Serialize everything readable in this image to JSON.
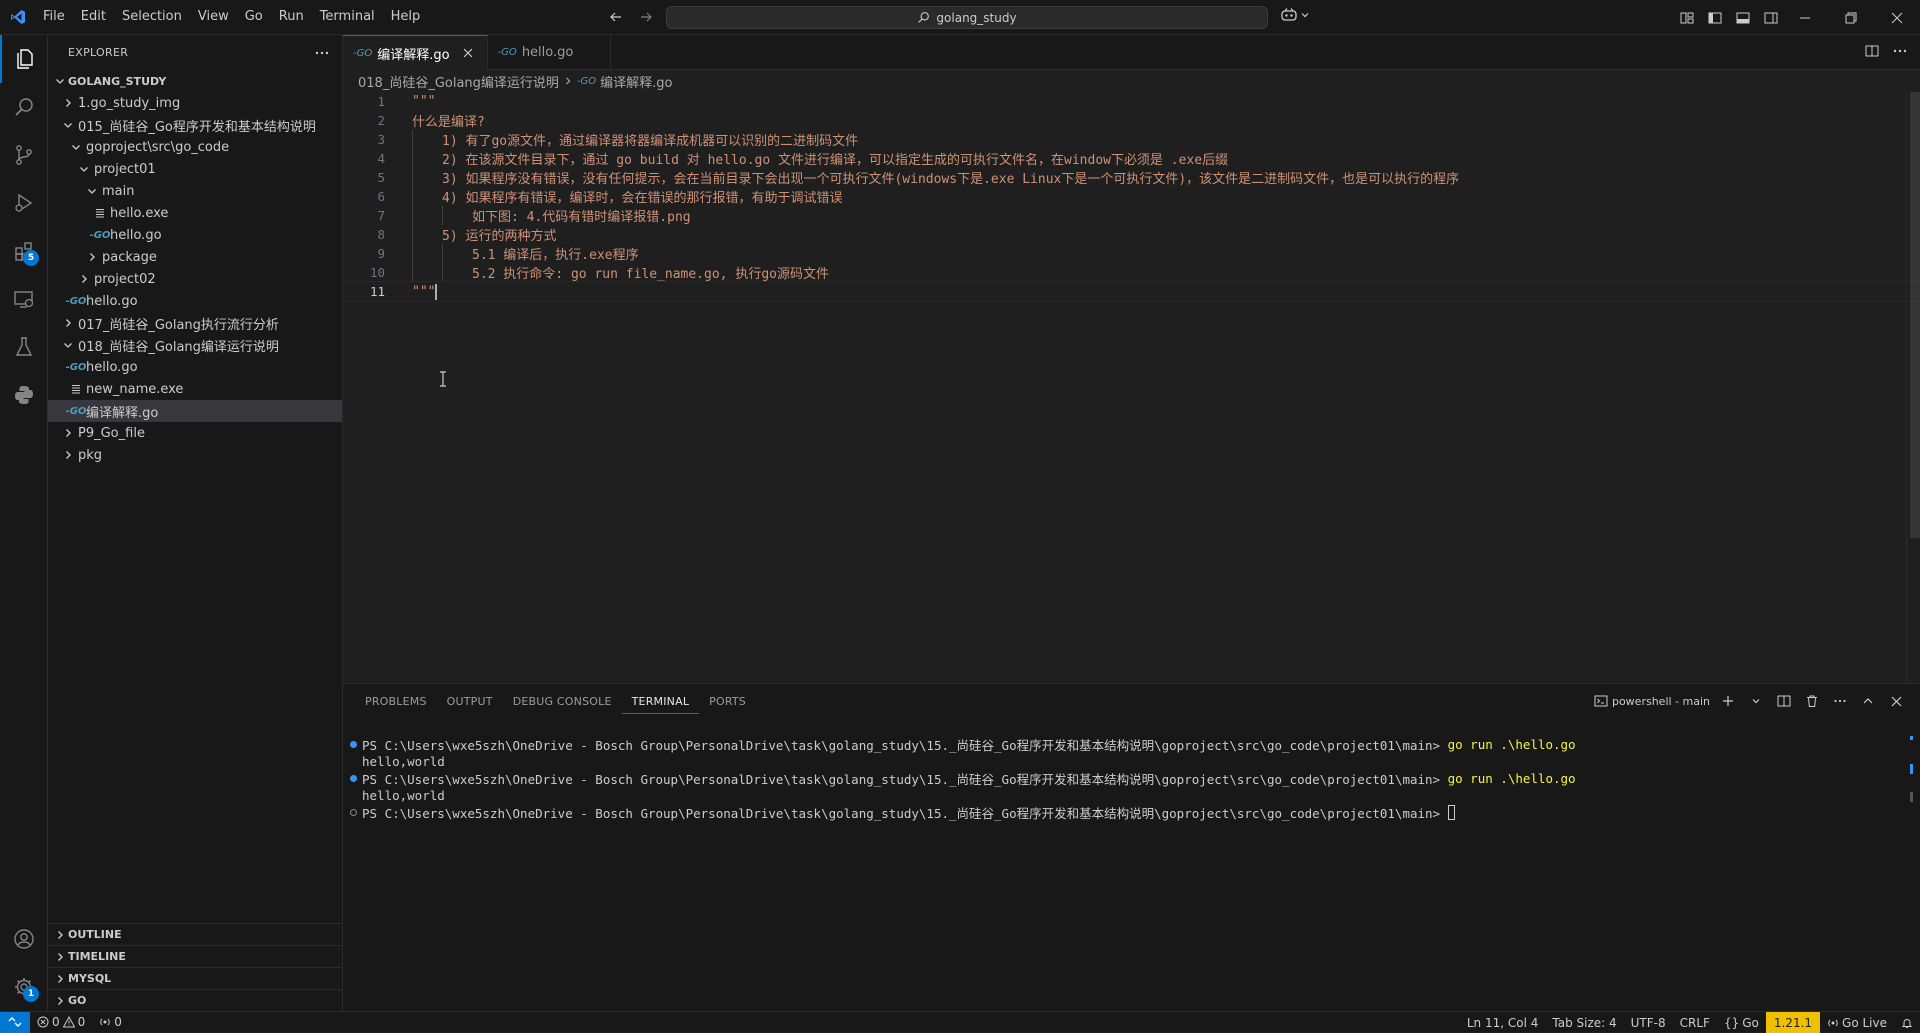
{
  "titlebar": {
    "menus": [
      "File",
      "Edit",
      "Selection",
      "View",
      "Go",
      "Run",
      "Terminal",
      "Help"
    ],
    "search_text": "golang_study"
  },
  "activity_badges": {
    "extensions": "5",
    "manage": "1"
  },
  "explorer": {
    "title": "EXPLORER",
    "root": "GOLANG_STUDY",
    "tree": [
      {
        "label": "1.go_study_img",
        "depth": 0,
        "kind": "folder",
        "expanded": false
      },
      {
        "label": "015_尚硅谷_Go程序开发和基本结构说明",
        "depth": 0,
        "kind": "folder",
        "expanded": true
      },
      {
        "label": "goproject\\src\\go_code",
        "depth": 1,
        "kind": "folder",
        "expanded": true
      },
      {
        "label": "project01",
        "depth": 2,
        "kind": "folder",
        "expanded": true
      },
      {
        "label": "main",
        "depth": 3,
        "kind": "folder",
        "expanded": true
      },
      {
        "label": "hello.exe",
        "depth": 4,
        "kind": "exe"
      },
      {
        "label": "hello.go",
        "depth": 4,
        "kind": "go"
      },
      {
        "label": "package",
        "depth": 3,
        "kind": "folder",
        "expanded": false
      },
      {
        "label": "project02",
        "depth": 2,
        "kind": "folder",
        "expanded": false
      },
      {
        "label": "hello.go",
        "depth": 1,
        "kind": "go"
      },
      {
        "label": "017_尚硅谷_Golang执行流行分析",
        "depth": 0,
        "kind": "folder",
        "expanded": false
      },
      {
        "label": "018_尚硅谷_Golang编译运行说明",
        "depth": 0,
        "kind": "folder",
        "expanded": true
      },
      {
        "label": "hello.go",
        "depth": 1,
        "kind": "go"
      },
      {
        "label": "new_name.exe",
        "depth": 1,
        "kind": "exe"
      },
      {
        "label": "编译解释.go",
        "depth": 1,
        "kind": "go",
        "selected": true
      },
      {
        "label": "P9_Go_file",
        "depth": 0,
        "kind": "folder",
        "expanded": false
      },
      {
        "label": "pkg",
        "depth": 0,
        "kind": "folder",
        "expanded": false
      }
    ],
    "sections": [
      "OUTLINE",
      "TIMELINE",
      "MYSQL",
      "GO"
    ]
  },
  "editor": {
    "tabs": [
      {
        "label": "编译解释.go",
        "active": true
      },
      {
        "label": "hello.go",
        "active": false
      }
    ],
    "breadcrumb": [
      "018_尚硅谷_Golang编译运行说明",
      "编译解释.go"
    ],
    "lines": [
      {
        "n": "1",
        "indent": 0,
        "text": "\"\"\""
      },
      {
        "n": "2",
        "indent": 0,
        "text": "什么是编译?"
      },
      {
        "n": "3",
        "indent": 1,
        "text": "1) 有了go源文件，通过编译器将器编译成机器可以识别的二进制码文件"
      },
      {
        "n": "4",
        "indent": 1,
        "text": "2) 在该源文件目录下，通过 go build 对 hello.go 文件进行编译，可以指定生成的可执行文件名，在window下必须是 .exe后缀"
      },
      {
        "n": "5",
        "indent": 1,
        "text": "3) 如果程序没有错误，没有任何提示，会在当前目录下会出现一个可执行文件(windows下是.exe Linux下是一个可执行文件)，该文件是二进制码文件，也是可以执行的程序"
      },
      {
        "n": "6",
        "indent": 1,
        "text": "4) 如果程序有错误，编译时，会在错误的那行报错，有助于调试错误"
      },
      {
        "n": "7",
        "indent": 2,
        "text": "如下图: 4.代码有错时编译报错.png"
      },
      {
        "n": "8",
        "indent": 1,
        "text": "5) 运行的两种方式"
      },
      {
        "n": "9",
        "indent": 2,
        "text": "5.1 编译后，执行.exe程序"
      },
      {
        "n": "10",
        "indent": 2,
        "text": "5.2 执行命令: go run file_name.go, 执行go源码文件"
      },
      {
        "n": "11",
        "indent": 0,
        "text": "\"\"\"",
        "current": true
      }
    ]
  },
  "panel": {
    "tabs": [
      "PROBLEMS",
      "OUTPUT",
      "DEBUG CONSOLE",
      "TERMINAL",
      "PORTS"
    ],
    "active_tab": "TERMINAL",
    "terminal_name": "powershell - main",
    "lines": [
      {
        "dot": "ok",
        "prompt": "PS C:\\Users\\wxe5szh\\OneDrive - Bosch Group\\PersonalDrive\\task\\golang_study\\15._尚硅谷_Go程序开发和基本结构说明\\goproject\\src\\go_code\\project01\\main> ",
        "cmd": "go run .\\hello.go"
      },
      {
        "dot": "",
        "prompt": "hello,world",
        "cmd": ""
      },
      {
        "dot": "ok",
        "prompt": "PS C:\\Users\\wxe5szh\\OneDrive - Bosch Group\\PersonalDrive\\task\\golang_study\\15._尚硅谷_Go程序开发和基本结构说明\\goproject\\src\\go_code\\project01\\main> ",
        "cmd": "go run .\\hello.go"
      },
      {
        "dot": "",
        "prompt": "hello,world",
        "cmd": ""
      },
      {
        "dot": "empty",
        "prompt": "PS C:\\Users\\wxe5szh\\OneDrive - Bosch Group\\PersonalDrive\\task\\golang_study\\15._尚硅谷_Go程序开发和基本结构说明\\goproject\\src\\go_code\\project01\\main> ",
        "cmd": "",
        "cursor": true
      }
    ]
  },
  "statusbar": {
    "errors": "0",
    "warnings": "0",
    "ports": "0",
    "position": "Ln 11, Col 4",
    "tab_size": "Tab Size: 4",
    "encoding": "UTF-8",
    "eol": "CRLF",
    "language": "Go",
    "go_version": "1.21.1",
    "go_live": "Go Live"
  },
  "colors": {
    "accent": "#0078d4",
    "string": "#ce9178",
    "go_icon": "#519aba",
    "go_version_bg": "#f0c000"
  }
}
